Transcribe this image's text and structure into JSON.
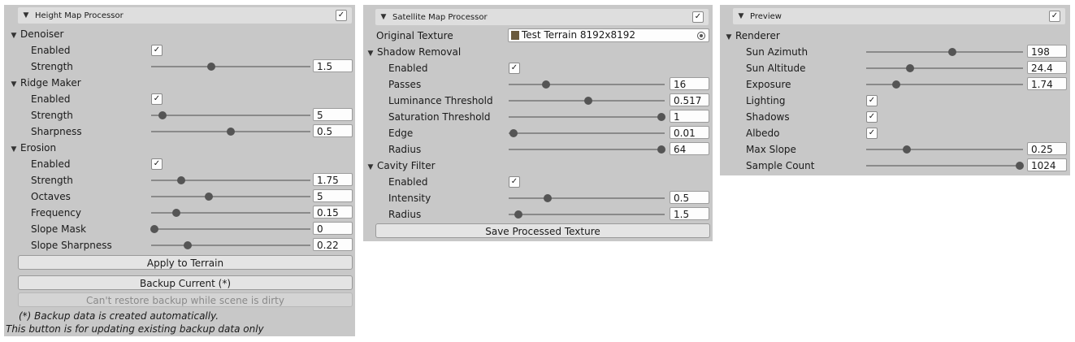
{
  "height_map_processor": {
    "title": "Height Map Processor",
    "enabled": true,
    "sections": [
      {
        "label": "Denoiser",
        "rows": [
          {
            "type": "toggle",
            "label": "Enabled",
            "checked": true
          },
          {
            "type": "slider",
            "label": "Strength",
            "value": "1.5",
            "level": 0.38
          }
        ]
      },
      {
        "label": "Ridge Maker",
        "rows": [
          {
            "type": "toggle",
            "label": "Enabled",
            "checked": true
          },
          {
            "type": "slider",
            "label": "Strength",
            "value": "5",
            "level": 0.07
          },
          {
            "type": "slider",
            "label": "Sharpness",
            "value": "0.5",
            "level": 0.5
          }
        ]
      },
      {
        "label": "Erosion",
        "rows": [
          {
            "type": "toggle",
            "label": "Enabled",
            "checked": true
          },
          {
            "type": "slider",
            "label": "Strength",
            "value": "1.75",
            "level": 0.19
          },
          {
            "type": "slider",
            "label": "Octaves",
            "value": "5",
            "level": 0.36
          },
          {
            "type": "slider",
            "label": "Frequency",
            "value": "0.15",
            "level": 0.16
          },
          {
            "type": "slider",
            "label": "Slope Mask",
            "value": "0",
            "level": 0.02
          },
          {
            "type": "slider",
            "label": "Slope Sharpness",
            "value": "0.22",
            "level": 0.23
          }
        ]
      }
    ],
    "apply_button": "Apply to Terrain",
    "backup_button": "Backup Current (*)",
    "restore_button": "Can't restore backup while scene is dirty",
    "note_line1": "(*) Backup data is created automatically.",
    "note_line2": "This button is for updating existing backup data only"
  },
  "satellite_map_processor": {
    "title": "Satellite Map Processor",
    "enabled": true,
    "original_texture_label": "Original Texture",
    "original_texture_value": "Test Terrain 8192x8192",
    "sections": [
      {
        "label": "Shadow Removal",
        "rows": [
          {
            "type": "toggle",
            "label": "Enabled",
            "checked": true
          },
          {
            "type": "slider",
            "label": "Passes",
            "value": "16",
            "level": 0.24
          },
          {
            "type": "slider",
            "label": "Luminance Threshold",
            "value": "0.517",
            "level": 0.51
          },
          {
            "type": "slider",
            "label": "Saturation Threshold",
            "value": "1",
            "level": 0.98
          },
          {
            "type": "slider",
            "label": "Edge",
            "value": "0.01",
            "level": 0.03
          },
          {
            "type": "slider",
            "label": "Radius",
            "value": "64",
            "level": 0.98
          }
        ]
      },
      {
        "label": "Cavity Filter",
        "rows": [
          {
            "type": "toggle",
            "label": "Enabled",
            "checked": true
          },
          {
            "type": "slider",
            "label": "Intensity",
            "value": "0.5",
            "level": 0.25
          },
          {
            "type": "slider",
            "label": "Radius",
            "value": "1.5",
            "level": 0.06
          }
        ]
      }
    ],
    "save_button": "Save Processed Texture"
  },
  "preview": {
    "title": "Preview",
    "enabled": true,
    "sections": [
      {
        "label": "Renderer",
        "rows": [
          {
            "type": "slider",
            "label": "Sun Azimuth",
            "value": "198",
            "level": 0.55
          },
          {
            "type": "slider",
            "label": "Sun Altitude",
            "value": "24.4",
            "level": 0.28
          },
          {
            "type": "slider",
            "label": "Exposure",
            "value": "1.74",
            "level": 0.19
          },
          {
            "type": "toggle",
            "label": "Lighting",
            "checked": true
          },
          {
            "type": "toggle",
            "label": "Shadows",
            "checked": true
          },
          {
            "type": "toggle",
            "label": "Albedo",
            "checked": true
          },
          {
            "type": "slider",
            "label": "Max Slope",
            "value": "0.25",
            "level": 0.26
          },
          {
            "type": "slider",
            "label": "Sample Count",
            "value": "1024",
            "level": 0.98
          }
        ]
      }
    ]
  },
  "icons": {
    "foldout": "triangle-down-icon",
    "check": "checkmark-icon",
    "texture": "texture-thumbnail-icon",
    "object_picker": "object-picker-icon"
  },
  "colors": {
    "panel_bg": "#c8c8c8",
    "header_bg": "#dedede",
    "field_bg": "#fdfdfd",
    "slider_thumb": "#555555",
    "slider_track": "#8a8a8a"
  }
}
